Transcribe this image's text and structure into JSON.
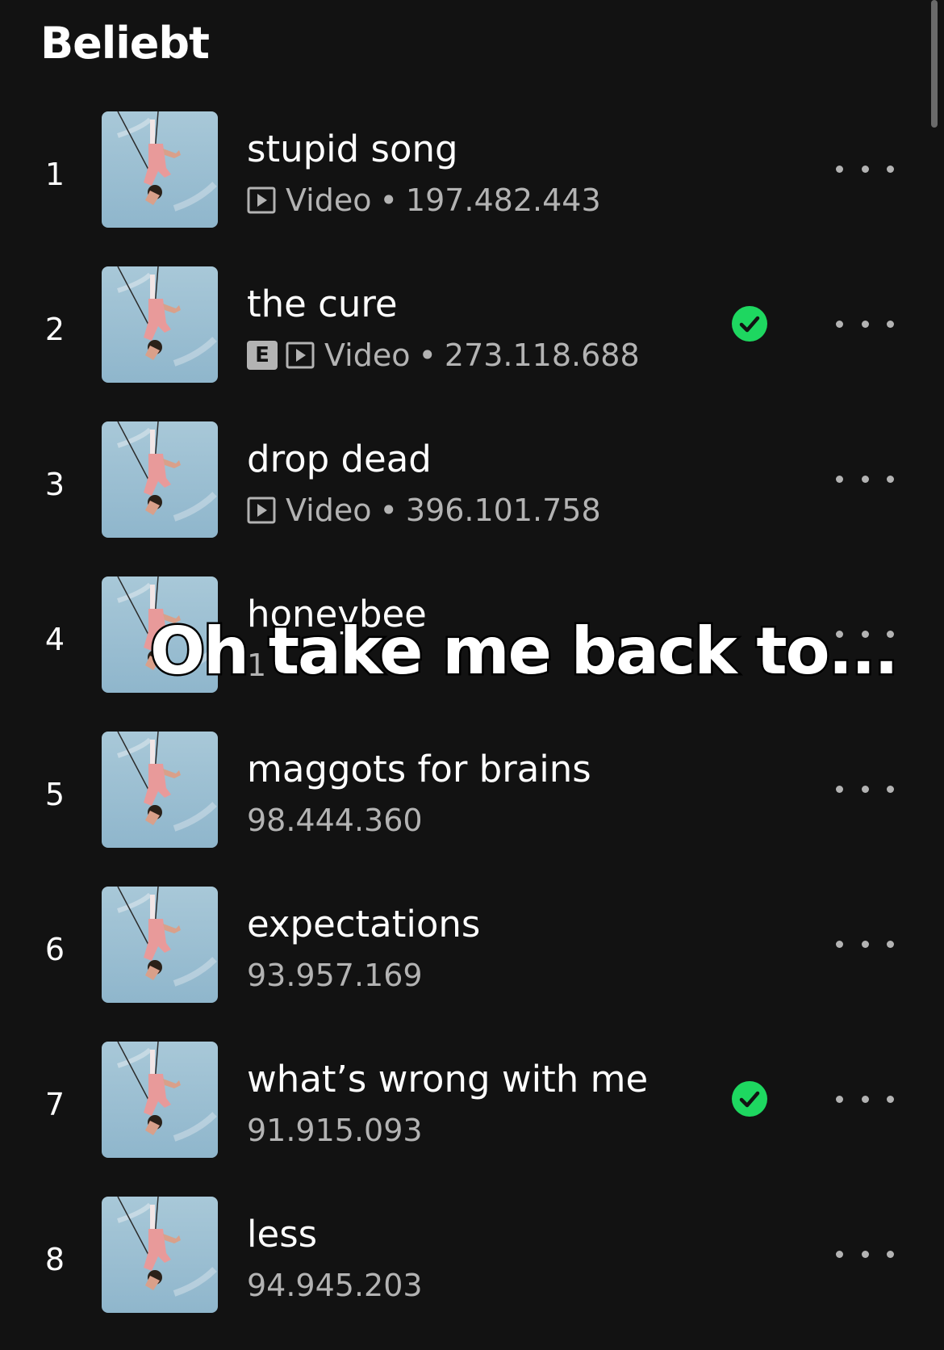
{
  "section": {
    "title": "Beliebt"
  },
  "meta_separator": "•",
  "tracks": [
    {
      "rank": "1",
      "title": "stupid song",
      "explicit": false,
      "video": true,
      "video_label": "Video",
      "plays": "197.482.443",
      "saved": false
    },
    {
      "rank": "2",
      "title": "the cure",
      "explicit": true,
      "explicit_label": "E",
      "video": true,
      "video_label": "Video",
      "plays": "273.118.688",
      "saved": true
    },
    {
      "rank": "3",
      "title": "drop dead",
      "explicit": false,
      "video": true,
      "video_label": "Video",
      "plays": "396.101.758",
      "saved": false
    },
    {
      "rank": "4",
      "title": "honeybee",
      "explicit": false,
      "video": false,
      "plays": "1",
      "saved": false
    },
    {
      "rank": "5",
      "title": "maggots for brains",
      "explicit": false,
      "video": false,
      "plays": "98.444.360",
      "saved": false
    },
    {
      "rank": "6",
      "title": "expectations",
      "explicit": false,
      "video": false,
      "plays": "93.957.169",
      "saved": false
    },
    {
      "rank": "7",
      "title": "what’s wrong with me",
      "explicit": false,
      "video": false,
      "plays": "91.915.093",
      "saved": true
    },
    {
      "rank": "8",
      "title": "less",
      "explicit": false,
      "video": false,
      "plays": "94.945.203",
      "saved": false
    }
  ],
  "overlay": {
    "caption": "Oh take me back to..."
  },
  "colors": {
    "background": "#121212",
    "text_primary": "#ffffff",
    "text_secondary": "#b3b3b3",
    "saved_check": "#1ed760",
    "cover_sky": "#9fc3d6"
  },
  "icons": {
    "video": "play-square-icon",
    "saved": "check-circle-icon",
    "more": "more-horizontal-icon",
    "explicit": "explicit-badge"
  }
}
